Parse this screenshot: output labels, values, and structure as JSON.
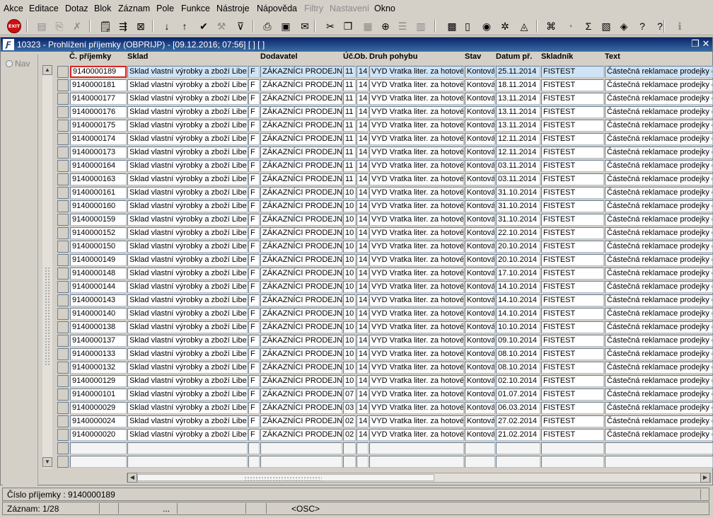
{
  "menu": [
    {
      "label": "Akce",
      "disabled": false
    },
    {
      "label": "Editace",
      "disabled": false
    },
    {
      "label": "Dotaz",
      "disabled": false
    },
    {
      "label": "Blok",
      "disabled": false
    },
    {
      "label": "Záznam",
      "disabled": false
    },
    {
      "label": "Pole",
      "disabled": false
    },
    {
      "label": "Funkce",
      "disabled": false
    },
    {
      "label": "Nástroje",
      "disabled": false
    },
    {
      "label": "Nápověda",
      "disabled": false
    },
    {
      "label": "Filtry",
      "disabled": true
    },
    {
      "label": "Nastavení",
      "disabled": true
    },
    {
      "label": "Okno",
      "disabled": false
    }
  ],
  "toolbar": {
    "exit_label": "EXIT",
    "tools": [
      "new-record-icon",
      "insert-icon",
      "delete-icon",
      "query-icon",
      "query-execute-icon",
      "query-cancel-icon",
      "sort-asc-icon",
      "sort-desc-icon",
      "checkmark-icon",
      "wrench-icon",
      "filter-icon",
      "print-icon",
      "print-preview-icon",
      "email-icon",
      "cut-icon",
      "copy-icon",
      "paste-icon",
      "zoom-icon",
      "list-icon",
      "columns-icon",
      "calculator-icon",
      "document-icon",
      "globe-icon",
      "settings-icon",
      "chart-icon",
      "flowchart-icon",
      "clock-icon",
      "sum-icon",
      "excel-icon",
      "help-book-icon",
      "help-topic-icon",
      "question-icon",
      "info-icon"
    ]
  },
  "window": {
    "title": "10323 - Prohlížení příjemky (OBPRIJP) - [09.12.2016; 07:56]  [ ]  [ ]",
    "icon_label": "Ƒ",
    "restore_glyph": "❐",
    "close_glyph": "✕"
  },
  "nav": {
    "label": "Nav"
  },
  "columns": [
    "Č. příjemky",
    "Sklad",
    "Dodavatel",
    "Úč.",
    "Ob.",
    "Druh pohybu",
    "Stav",
    "Datum př.",
    "Skladník",
    "Text"
  ],
  "rows": [
    [
      "9140000189",
      "Sklad vlastní výrobky a zboží Liber",
      "F",
      "ZÁKAZNÍCI PRODEJNY",
      "11",
      "14",
      "VYD Vratka liter. za hotové",
      "Kontová",
      "25.11.2014",
      "FISTEST",
      "Částečná reklamace prodejky č"
    ],
    [
      "9140000181",
      "Sklad vlastní výrobky a zboží Liber",
      "F",
      "ZÁKAZNÍCI PRODEJNY",
      "11",
      "14",
      "VYD Vratka liter. za hotové",
      "Kontová",
      "18.11.2014",
      "FISTEST",
      "Částečná reklamace prodejky č"
    ],
    [
      "9140000177",
      "Sklad vlastní výrobky a zboží Liber",
      "F",
      "ZÁKAZNÍCI PRODEJNY",
      "11",
      "14",
      "VYD Vratka liter. za hotové",
      "Kontová",
      "13.11.2014",
      "FISTEST",
      "Částečná reklamace prodejky č"
    ],
    [
      "9140000176",
      "Sklad vlastní výrobky a zboží Liber",
      "F",
      "ZÁKAZNÍCI PRODEJNY",
      "11",
      "14",
      "VYD Vratka liter. za hotové",
      "Kontová",
      "13.11.2014",
      "FISTEST",
      "Částečná reklamace prodejky č"
    ],
    [
      "9140000175",
      "Sklad vlastní výrobky a zboží Liber",
      "F",
      "ZÁKAZNÍCI PRODEJNY",
      "11",
      "14",
      "VYD Vratka liter. za hotové",
      "Kontová",
      "13.11.2014",
      "FISTEST",
      "Částečná reklamace prodejky č"
    ],
    [
      "9140000174",
      "Sklad vlastní výrobky a zboží Liber",
      "F",
      "ZÁKAZNÍCI PRODEJNY",
      "11",
      "14",
      "VYD Vratka liter. za hotové",
      "Kontová",
      "12.11.2014",
      "FISTEST",
      "Částečná reklamace prodejky č"
    ],
    [
      "9140000173",
      "Sklad vlastní výrobky a zboží Liber",
      "F",
      "ZÁKAZNÍCI PRODEJNY",
      "11",
      "14",
      "VYD Vratka liter. za hotové",
      "Kontová",
      "12.11.2014",
      "FISTEST",
      "Částečná reklamace prodejky č"
    ],
    [
      "9140000164",
      "Sklad vlastní výrobky a zboží Liber",
      "F",
      "ZÁKAZNÍCI PRODEJNY",
      "11",
      "14",
      "VYD Vratka liter. za hotové",
      "Kontová",
      "03.11.2014",
      "FISTEST",
      "Částečná reklamace prodejky č"
    ],
    [
      "9140000163",
      "Sklad vlastní výrobky a zboží Liber",
      "F",
      "ZÁKAZNÍCI PRODEJNY",
      "11",
      "14",
      "VYD Vratka liter. za hotové",
      "Kontová",
      "03.11.2014",
      "FISTEST",
      "Částečná reklamace prodejky č"
    ],
    [
      "9140000161",
      "Sklad vlastní výrobky a zboží Liber",
      "F",
      "ZÁKAZNÍCI PRODEJNY",
      "10",
      "14",
      "VYD Vratka liter. za hotové",
      "Kontová",
      "31.10.2014",
      "FISTEST",
      "Částečná reklamace prodejky č"
    ],
    [
      "9140000160",
      "Sklad vlastní výrobky a zboží Liber",
      "F",
      "ZÁKAZNÍCI PRODEJNY",
      "10",
      "14",
      "VYD Vratka liter. za hotové",
      "Kontová",
      "31.10.2014",
      "FISTEST",
      "Částečná reklamace prodejky č"
    ],
    [
      "9140000159",
      "Sklad vlastní výrobky a zboží Liber",
      "F",
      "ZÁKAZNÍCI PRODEJNY",
      "10",
      "14",
      "VYD Vratka liter. za hotové",
      "Kontová",
      "31.10.2014",
      "FISTEST",
      "Částečná reklamace prodejky č"
    ],
    [
      "9140000152",
      "Sklad vlastní výrobky a zboží Liber",
      "F",
      "ZÁKAZNÍCI PRODEJNY",
      "10",
      "14",
      "VYD Vratka liter. za hotové",
      "Kontová",
      "22.10.2014",
      "FISTEST",
      "Částečná reklamace prodejky č"
    ],
    [
      "9140000150",
      "Sklad vlastní výrobky a zboží Liber",
      "F",
      "ZÁKAZNÍCI PRODEJNY",
      "10",
      "14",
      "VYD Vratka liter. za hotové",
      "Kontová",
      "20.10.2014",
      "FISTEST",
      "Částečná reklamace prodejky č"
    ],
    [
      "9140000149",
      "Sklad vlastní výrobky a zboží Liber",
      "F",
      "ZÁKAZNÍCI PRODEJNY",
      "10",
      "14",
      "VYD Vratka liter. za hotové",
      "Kontová",
      "20.10.2014",
      "FISTEST",
      "Částečná reklamace prodejky č"
    ],
    [
      "9140000148",
      "Sklad vlastní výrobky a zboží Liber",
      "F",
      "ZÁKAZNÍCI PRODEJNY",
      "10",
      "14",
      "VYD Vratka liter. za hotové",
      "Kontová",
      "17.10.2014",
      "FISTEST",
      "Částečná reklamace prodejky č"
    ],
    [
      "9140000144",
      "Sklad vlastní výrobky a zboží Liber",
      "F",
      "ZÁKAZNÍCI PRODEJNY",
      "10",
      "14",
      "VYD Vratka liter. za hotové",
      "Kontová",
      "14.10.2014",
      "FISTEST",
      "Částečná reklamace prodejky č"
    ],
    [
      "9140000143",
      "Sklad vlastní výrobky a zboží Liber",
      "F",
      "ZÁKAZNÍCI PRODEJNY",
      "10",
      "14",
      "VYD Vratka liter. za hotové",
      "Kontová",
      "14.10.2014",
      "FISTEST",
      "Částečná reklamace prodejky č"
    ],
    [
      "9140000140",
      "Sklad vlastní výrobky a zboží Liber",
      "F",
      "ZÁKAZNÍCI PRODEJNY",
      "10",
      "14",
      "VYD Vratka liter. za hotové",
      "Kontová",
      "14.10.2014",
      "FISTEST",
      "Částečná reklamace prodejky č"
    ],
    [
      "9140000138",
      "Sklad vlastní výrobky a zboží Liber",
      "F",
      "ZÁKAZNÍCI PRODEJNY",
      "10",
      "14",
      "VYD Vratka liter. za hotové",
      "Kontová",
      "10.10.2014",
      "FISTEST",
      "Částečná reklamace prodejky č"
    ],
    [
      "9140000137",
      "Sklad vlastní výrobky a zboží Liber",
      "F",
      "ZÁKAZNÍCI PRODEJNY",
      "10",
      "14",
      "VYD Vratka liter. za hotové",
      "Kontová",
      "09.10.2014",
      "FISTEST",
      "Částečná reklamace prodejky č"
    ],
    [
      "9140000133",
      "Sklad vlastní výrobky a zboží Liber",
      "F",
      "ZÁKAZNÍCI PRODEJNY",
      "10",
      "14",
      "VYD Vratka liter. za hotové",
      "Kontová",
      "08.10.2014",
      "FISTEST",
      "Částečná reklamace prodejky č"
    ],
    [
      "9140000132",
      "Sklad vlastní výrobky a zboží Liber",
      "F",
      "ZÁKAZNÍCI PRODEJNY",
      "10",
      "14",
      "VYD Vratka liter. za hotové",
      "Kontová",
      "08.10.2014",
      "FISTEST",
      "Částečná reklamace prodejky č"
    ],
    [
      "9140000129",
      "Sklad vlastní výrobky a zboží Liber",
      "F",
      "ZÁKAZNÍCI PRODEJNY",
      "10",
      "14",
      "VYD Vratka liter. za hotové",
      "Kontová",
      "02.10.2014",
      "FISTEST",
      "Částečná reklamace prodejky č"
    ],
    [
      "9140000101",
      "Sklad vlastní výrobky a zboží Liber",
      "F",
      "ZÁKAZNÍCI PRODEJNY",
      "07",
      "14",
      "VYD Vratka liter. za hotové",
      "Kontová",
      "01.07.2014",
      "FISTEST",
      "Částečná reklamace prodejky č"
    ],
    [
      "9140000029",
      "Sklad vlastní výrobky a zboží Liber",
      "F",
      "ZÁKAZNÍCI PRODEJNY",
      "03",
      "14",
      "VYD Vratka liter. za hotové",
      "Kontová",
      "06.03.2014",
      "FISTEST",
      "Částečná reklamace prodejky č"
    ],
    [
      "9140000024",
      "Sklad vlastní výrobky a zboží Liber",
      "F",
      "ZÁKAZNÍCI PRODEJNY",
      "02",
      "14",
      "VYD Vratka liter. za hotové",
      "Kontová",
      "27.02.2014",
      "FISTEST",
      "Částečná reklamace prodejky č"
    ],
    [
      "9140000020",
      "Sklad vlastní výrobky a zboží Liber",
      "F",
      "ZÁKAZNÍCI PRODEJNY",
      "02",
      "14",
      "VYD Vratka liter. za hotové",
      "Kontová",
      "21.02.2014",
      "FISTEST",
      "Částečná reklamace prodejky č"
    ]
  ],
  "scroll": {
    "up_glyph": "▲",
    "down_glyph": "▼",
    "left_glyph": "◀",
    "right_glyph": "▶"
  },
  "status": {
    "field_info": "Číslo příjemky : 9140000189",
    "record": "Záznam: 1/28",
    "ellipsis": "...",
    "mode": "<OSC>"
  },
  "colors": {
    "titlebar": "#0a246a",
    "selected_row": "#cfe3f7",
    "current_cell_border": "#dd2222",
    "exit_button": "#cc1010"
  }
}
